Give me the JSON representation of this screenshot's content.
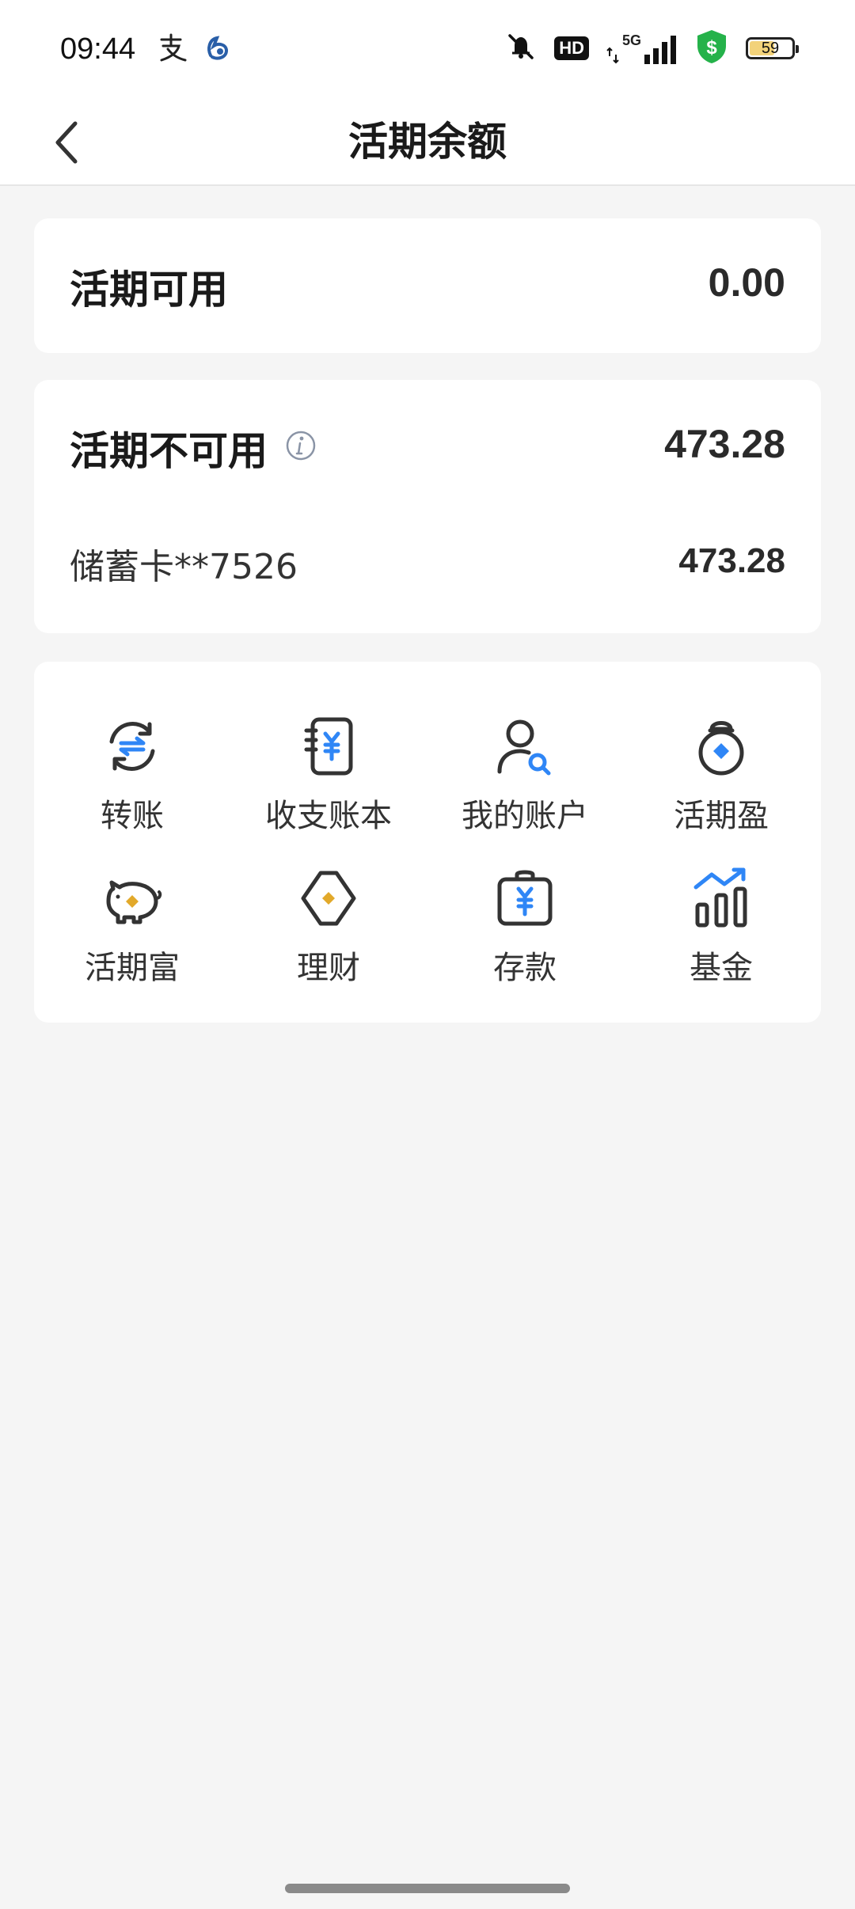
{
  "status_bar": {
    "time": "09:44",
    "app_icons": [
      "alipay-icon",
      "bank-app-icon"
    ],
    "icons": [
      "mute-bell-icon",
      "hd-badge",
      "signal-5g-icon",
      "security-shield-icon",
      "battery-icon"
    ],
    "hd_label": "HD",
    "network_label": "5G",
    "battery_level": "59",
    "battery_fraction": 0.59,
    "shield_color": "#25b24a"
  },
  "nav": {
    "title": "活期余额",
    "back_icon": "chevron-left-icon"
  },
  "available": {
    "label": "活期可用",
    "amount": "0.00"
  },
  "unavailable": {
    "label": "活期不可用",
    "info_icon": "info-icon",
    "amount": "473.28",
    "accounts": [
      {
        "name": "储蓄卡**7526",
        "amount": "473.28"
      }
    ]
  },
  "services": {
    "items": [
      {
        "label": "转账",
        "icon": "transfer-icon"
      },
      {
        "label": "收支账本",
        "icon": "ledger-icon"
      },
      {
        "label": "我的账户",
        "icon": "account-search-icon"
      },
      {
        "label": "活期盈",
        "icon": "money-bag-icon"
      },
      {
        "label": "活期富",
        "icon": "piggy-bank-icon"
      },
      {
        "label": "理财",
        "icon": "wealth-diamond-icon"
      },
      {
        "label": "存款",
        "icon": "deposit-bag-icon"
      },
      {
        "label": "基金",
        "icon": "fund-chart-icon"
      }
    ]
  },
  "colors": {
    "accent_blue": "#2f86f6",
    "accent_gold": "#e2a92a",
    "icon_dark": "#333333"
  }
}
